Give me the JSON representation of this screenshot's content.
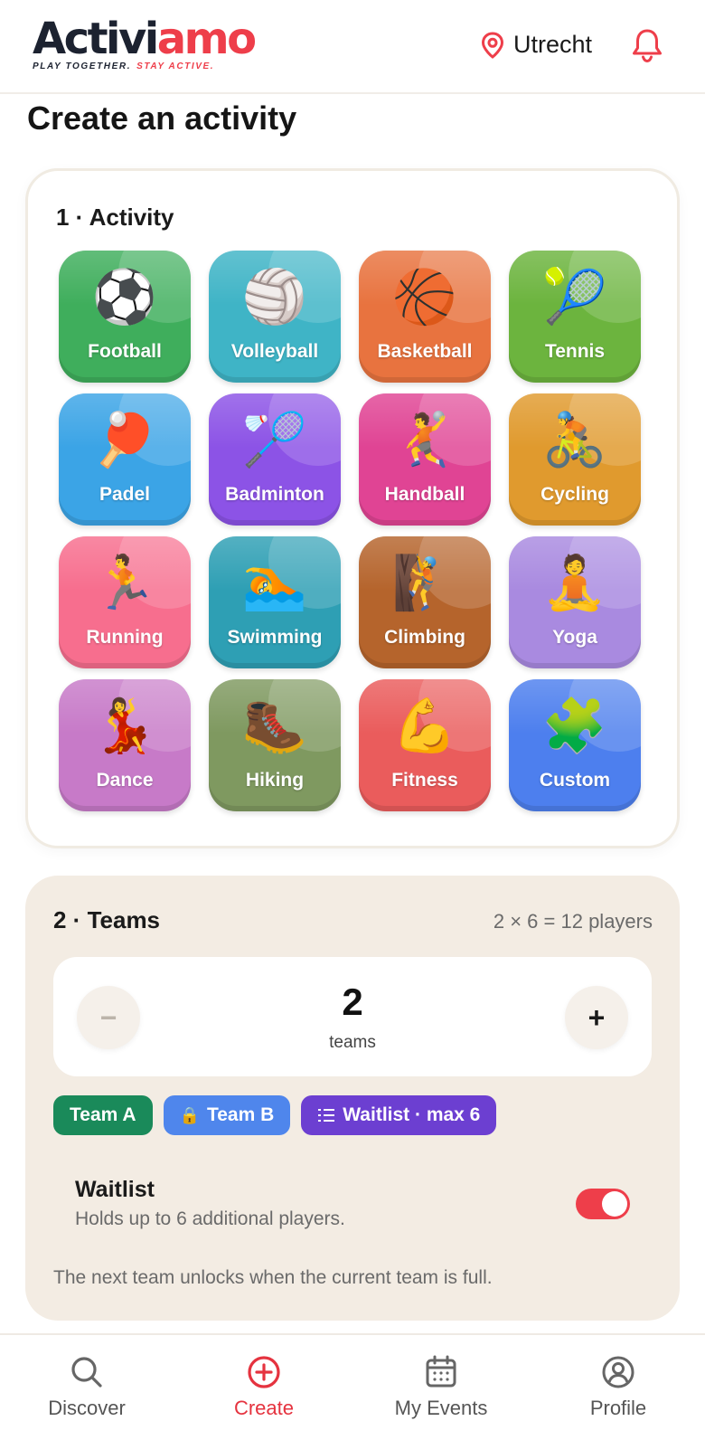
{
  "header": {
    "logo_part1": "Activi",
    "logo_part2": "amo",
    "tagline_part1": "PLAY TOGETHER.",
    "tagline_part2": "STAY ACTIVE.",
    "location": "Utrecht"
  },
  "page_title": "Create an activity",
  "activity": {
    "section_title": "1 · Activity",
    "tiles": [
      {
        "label": "Football",
        "icon": "⚽",
        "color": "#3fae5c"
      },
      {
        "label": "Volleyball",
        "icon": "🏐",
        "color": "#3fb4c6"
      },
      {
        "label": "Basketball",
        "icon": "🏀",
        "color": "#e8733f"
      },
      {
        "label": "Tennis",
        "icon": "🎾",
        "color": "#6cb43e"
      },
      {
        "label": "Padel",
        "icon": "🏓",
        "color": "#3ba4e6"
      },
      {
        "label": "Badminton",
        "icon": "🏸",
        "color": "#8c53e6"
      },
      {
        "label": "Handball",
        "icon": "🤾",
        "color": "#e04494"
      },
      {
        "label": "Cycling",
        "icon": "🚴",
        "color": "#e09a2e"
      },
      {
        "label": "Running",
        "icon": "🏃",
        "color": "#f76e8e"
      },
      {
        "label": "Swimming",
        "icon": "🏊",
        "color": "#2e9fb4"
      },
      {
        "label": "Climbing",
        "icon": "🧗",
        "color": "#b5642c"
      },
      {
        "label": "Yoga",
        "icon": "🧘",
        "color": "#a98ae0"
      },
      {
        "label": "Dance",
        "icon": "💃",
        "color": "#c77ac8"
      },
      {
        "label": "Hiking",
        "icon": "🥾",
        "color": "#7f9960"
      },
      {
        "label": "Fitness",
        "icon": "💪",
        "color": "#ea5c5c"
      },
      {
        "label": "Custom",
        "icon": "🧩",
        "color": "#4d7fee"
      }
    ]
  },
  "teams": {
    "section_title": "2 · Teams",
    "players_summary": "2 × 6 = 12 players",
    "count": "2",
    "count_unit": "teams",
    "minus_label": "−",
    "plus_label": "+",
    "chips": {
      "team_a": "Team A",
      "team_b": "Team B",
      "waitlist": "Waitlist · max 6"
    },
    "waitlist_title": "Waitlist",
    "waitlist_desc": "Holds up to 6 additional players.",
    "waitlist_enabled": true,
    "unlock_note": "The next team unlocks when the current team is full."
  },
  "nav": {
    "discover": "Discover",
    "create": "Create",
    "my_events": "My Events",
    "profile": "Profile"
  },
  "colors": {
    "brand": "#ee3e4a",
    "team_a": "#1a8a5a",
    "team_b": "#4f86ec",
    "waitlist": "#6c3fd1"
  }
}
